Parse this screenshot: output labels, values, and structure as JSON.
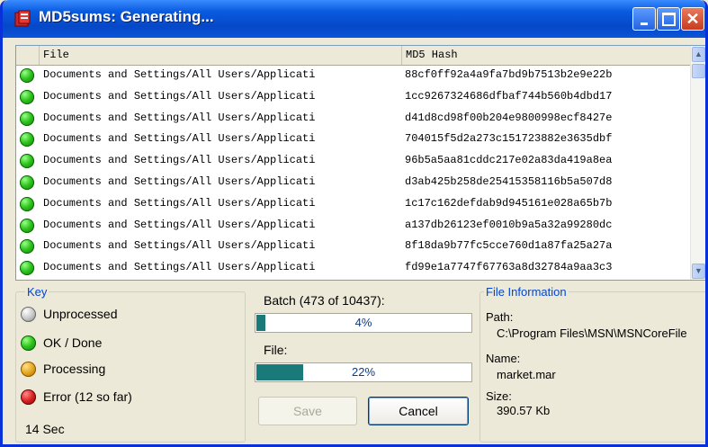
{
  "window": {
    "title": "MD5sums: Generating..."
  },
  "list": {
    "columns": [
      "File",
      "MD5 Hash"
    ],
    "rows": [
      {
        "file": "Documents and Settings/All Users/Applicati",
        "hash": "88cf0ff92a4a9fa7bd9b7513b2e9e22b"
      },
      {
        "file": "Documents and Settings/All Users/Applicati",
        "hash": "1cc9267324686dfbaf744b560b4dbd17"
      },
      {
        "file": "Documents and Settings/All Users/Applicati",
        "hash": "d41d8cd98f00b204e9800998ecf8427e"
      },
      {
        "file": "Documents and Settings/All Users/Applicati",
        "hash": "704015f5d2a273c151723882e3635dbf"
      },
      {
        "file": "Documents and Settings/All Users/Applicati",
        "hash": "96b5a5aa81cddc217e02a83da419a8ea"
      },
      {
        "file": "Documents and Settings/All Users/Applicati",
        "hash": "d3ab425b258de25415358116b5a507d8"
      },
      {
        "file": "Documents and Settings/All Users/Applicati",
        "hash": "1c17c162defdab9d945161e028a65b7b"
      },
      {
        "file": "Documents and Settings/All Users/Applicati",
        "hash": "a137db26123ef0010b9a5a32a99280dc"
      },
      {
        "file": "Documents and Settings/All Users/Applicati",
        "hash": "8f18da9b77fc5cce760d1a87fa25a27a"
      },
      {
        "file": "Documents and Settings/All Users/Applicati",
        "hash": "fd99e1a7747f67763a8d32784a9aa3c3"
      }
    ]
  },
  "key": {
    "title": "Key",
    "items": [
      "Unprocessed",
      "OK / Done",
      "Processing",
      "Error  (12 so far)"
    ],
    "elapsed": "14 Sec"
  },
  "progress": {
    "batch_label": "Batch (473 of 10437):",
    "batch_percent_text": "4%",
    "batch_fraction": 0.04,
    "file_label": "File:",
    "file_percent_text": "22%",
    "file_fraction": 0.22
  },
  "buttons": {
    "save": "Save",
    "cancel": "Cancel"
  },
  "file_info": {
    "title": "File Information",
    "path_label": "Path:",
    "path_value": "C:\\Program Files\\MSN\\MSNCoreFile",
    "name_label": "Name:",
    "name_value": "market.mar",
    "size_label": "Size:",
    "size_value": "390.57 Kb"
  },
  "colors": {
    "title_bar": "#0A55D8",
    "ok": "#2EC51E",
    "progress_fill": "#1A7A7A",
    "group_title": "#0046D5"
  }
}
